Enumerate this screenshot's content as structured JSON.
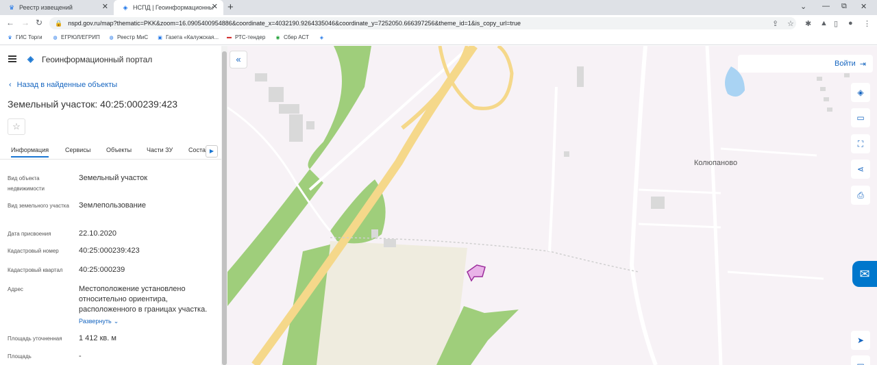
{
  "browser": {
    "tabs": [
      {
        "title": "Реестр извещений",
        "active": false
      },
      {
        "title": "НСПД | Геоинформационный п",
        "active": true
      }
    ],
    "url": "nspd.gov.ru/map?thematic=PKK&zoom=16.0905400954886&coordinate_x=4032190.9264335046&coordinate_y=7252050.666397256&theme_id=1&is_copy_url=true",
    "bookmarks": [
      "ГИС Торги",
      "ЕГРЮЛ/ЕГРИП",
      "Реестр МиС",
      "Газета «Калужская...",
      "РТС-тендер",
      "Сбер АСТ"
    ]
  },
  "portal": {
    "brand": "Геоинформационный портал",
    "back_label": "Назад в найденные объекты",
    "object_title": "Земельный участок: 40:25:000239:423",
    "tabs": [
      "Информация",
      "Сервисы",
      "Объекты",
      "Части ЗУ",
      "Соста"
    ],
    "fields": [
      {
        "label": "Вид объекта недвижимости",
        "value": "Земельный участок"
      },
      {
        "label": "Вид земельного участка",
        "value": "Землепользование"
      },
      {
        "label": "Дата присвоения",
        "value": "22.10.2020"
      },
      {
        "label": "Кадастровый номер",
        "value": "40:25:000239:423"
      },
      {
        "label": "Кадастровый квартал",
        "value": "40:25:000239"
      },
      {
        "label": "Адрес",
        "value": "Местоположение установлено относительно ориентира, расположенного в границах участка.",
        "expand": "Развернуть"
      },
      {
        "label": "Площадь уточненная",
        "value": "1 412 кв. м"
      },
      {
        "label": "Площадь",
        "value": "-"
      }
    ]
  },
  "map": {
    "login_label": "Войти",
    "place_label": "Колюпаново",
    "parcel_color": "#e9b3e8",
    "parcel_border": "#9b2c9b",
    "road_color": "#f5d88a",
    "green_color": "#9fce7b"
  }
}
